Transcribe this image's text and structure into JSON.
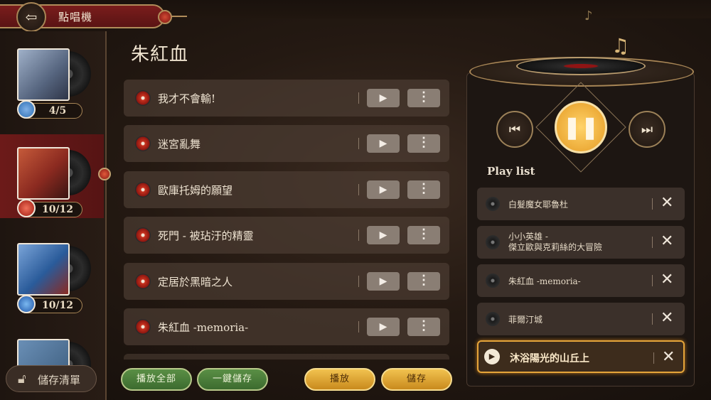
{
  "header": {
    "title": "點唱機"
  },
  "sidebar": {
    "albums": [
      {
        "count": "4/5",
        "cover_color": "#6f7f9c",
        "icon_color": "#2e6fb4"
      },
      {
        "count": "10/12",
        "cover_color": "#a23526",
        "icon_color": "#c3321f"
      },
      {
        "count": "10/12",
        "cover_color": "#2a5b9a",
        "icon_color": "#2f74c9"
      }
    ],
    "save_list_label": "儲存清單"
  },
  "main": {
    "album_title": "朱紅血",
    "songs": [
      {
        "title": "我才不會輸!"
      },
      {
        "title": "迷宮亂舞"
      },
      {
        "title": "歐庫托姆的願望"
      },
      {
        "title": "死門 - 被玷汙的精靈"
      },
      {
        "title": "定居於黑暗之人"
      },
      {
        "title": "朱紅血 -memoria-"
      }
    ],
    "play_all_label": "播放全部",
    "save_all_label": "一鍵儲存",
    "play_label": "播放",
    "save_label": "儲存"
  },
  "player": {
    "playlist_label": "Play list",
    "playlist": [
      {
        "title": "白髮魔女耶魯杜"
      },
      {
        "title_line1": "小小英雄 -",
        "title_line2": "傑立歐與克莉絲的大冒險"
      },
      {
        "title": "朱紅血 -memoria-"
      },
      {
        "title": "菲爾汀城"
      },
      {
        "title": "沐浴陽光的山丘上",
        "current": true
      }
    ]
  },
  "colors": {
    "accent_gold": "#f1c24f",
    "accent_red": "#7a1d1c",
    "green": "#4a7d3a"
  }
}
